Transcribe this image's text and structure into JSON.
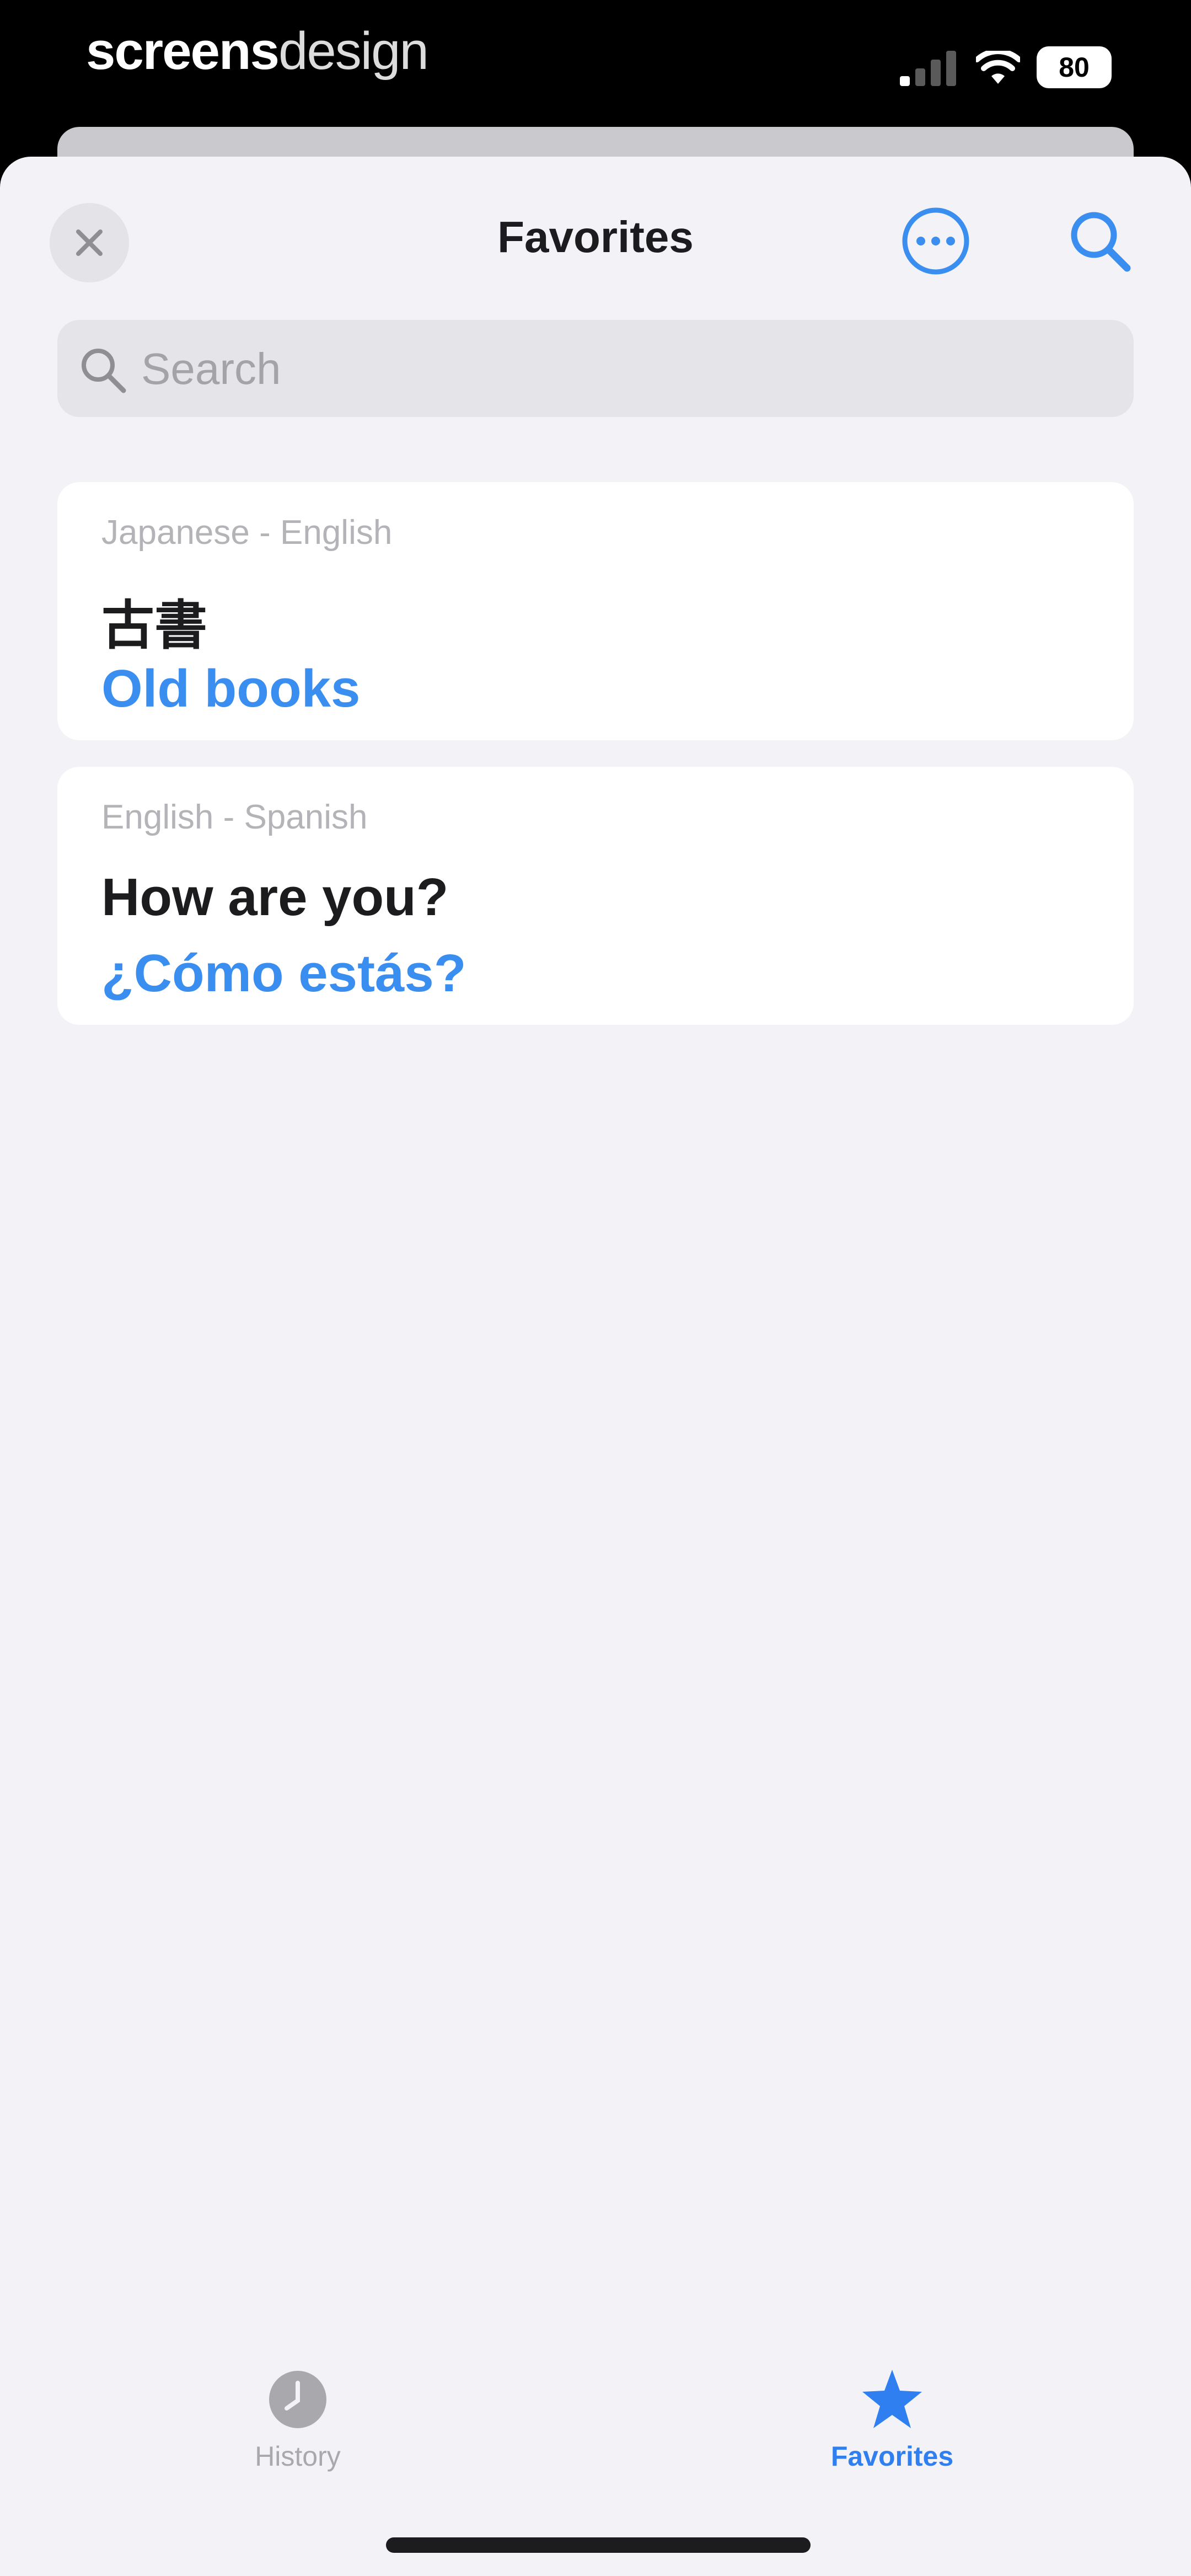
{
  "status_bar": {
    "brand_bold": "screens",
    "brand_light": "design",
    "battery": "80",
    "icons": [
      "signal-icon",
      "wifi-icon",
      "battery-icon"
    ]
  },
  "nav": {
    "title": "Favorites",
    "close_icon": "close-icon",
    "more_icon": "ellipsis-circle-icon",
    "search_icon": "search-icon"
  },
  "search": {
    "placeholder": "Search",
    "value": ""
  },
  "favorites": [
    {
      "languages": "Japanese - English",
      "source": "古書",
      "translation": "Old books"
    },
    {
      "languages": "English - Spanish",
      "source": "How are you?",
      "translation": "¿Cómo estás?"
    }
  ],
  "tabs": [
    {
      "label": "History",
      "icon": "clock-icon",
      "selected": false
    },
    {
      "label": "Favorites",
      "icon": "star-icon",
      "selected": true
    }
  ],
  "colors": {
    "accent": "#3a8ef0",
    "background": "#f2f2f7",
    "card": "#ffffff",
    "secondary_text": "#b3b3b8"
  }
}
